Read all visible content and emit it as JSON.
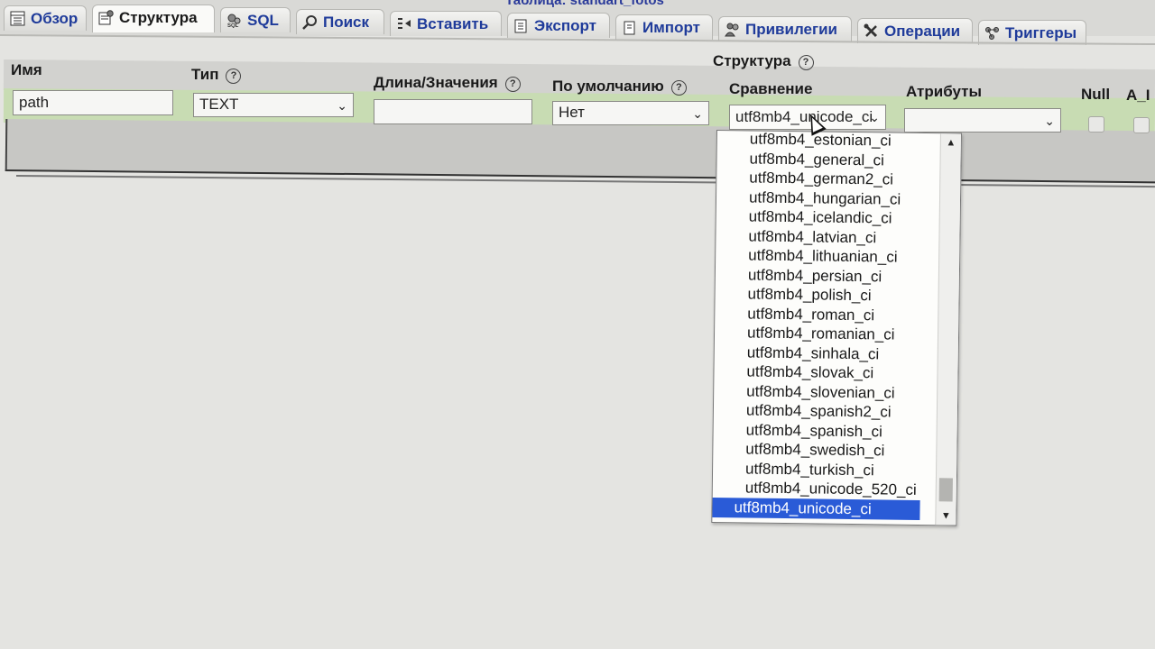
{
  "breadcrumb_partial": "Таблица: standart_fotos",
  "tabs": [
    {
      "label": "Обзор",
      "icon": "browse-icon"
    },
    {
      "label": "Структура",
      "icon": "structure-icon",
      "active": true
    },
    {
      "label": "SQL",
      "icon": "sql-icon"
    },
    {
      "label": "Поиск",
      "icon": "search-icon"
    },
    {
      "label": "Вставить",
      "icon": "insert-icon"
    },
    {
      "label": "Экспорт",
      "icon": "export-icon"
    },
    {
      "label": "Импорт",
      "icon": "import-icon"
    },
    {
      "label": "Привилегии",
      "icon": "privileges-icon"
    },
    {
      "label": "Операции",
      "icon": "operations-icon"
    },
    {
      "label": "Триггеры",
      "icon": "triggers-icon"
    }
  ],
  "structure": {
    "title": "Структура",
    "columns": {
      "name": "Имя",
      "type": "Тип",
      "length": "Длина/Значения",
      "default": "По умолчанию",
      "collation": "Сравнение",
      "attributes": "Атрибуты",
      "null": "Null",
      "ai": "A_I"
    },
    "row": {
      "name": "path",
      "type": "TEXT",
      "length": "",
      "default": "Нет",
      "collation": "utf8mb4_unicode_ci",
      "attributes": ""
    }
  },
  "collation_options": [
    "utf8mb4_estonian_ci",
    "utf8mb4_general_ci",
    "utf8mb4_german2_ci",
    "utf8mb4_hungarian_ci",
    "utf8mb4_icelandic_ci",
    "utf8mb4_latvian_ci",
    "utf8mb4_lithuanian_ci",
    "utf8mb4_persian_ci",
    "utf8mb4_polish_ci",
    "utf8mb4_roman_ci",
    "utf8mb4_romanian_ci",
    "utf8mb4_sinhala_ci",
    "utf8mb4_slovak_ci",
    "utf8mb4_slovenian_ci",
    "utf8mb4_spanish2_ci",
    "utf8mb4_spanish_ci",
    "utf8mb4_swedish_ci",
    "utf8mb4_turkish_ci",
    "utf8mb4_unicode_520_ci",
    "utf8mb4_unicode_ci"
  ],
  "collation_selected_index": 19,
  "colors": {
    "tab_text": "#1f3b9a",
    "row_highlight": "#c8dcb3",
    "selected_option": "#2a5bd7"
  }
}
